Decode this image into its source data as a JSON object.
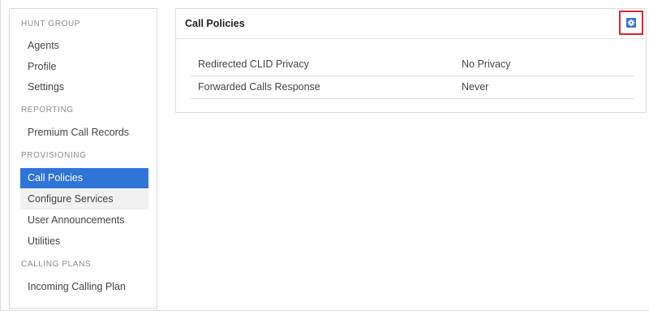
{
  "sidebar": {
    "sections": [
      {
        "heading": "HUNT GROUP",
        "items": [
          "Agents",
          "Profile",
          "Settings"
        ]
      },
      {
        "heading": "REPORTING",
        "items": [
          "Premium Call Records"
        ]
      },
      {
        "heading": "PROVISIONING",
        "items": [
          "Call Policies",
          "Configure Services",
          "User Announcements",
          "Utilities"
        ]
      },
      {
        "heading": "CALLING PLANS",
        "items": [
          "Incoming Calling Plan"
        ]
      }
    ],
    "active_item": "Call Policies",
    "hovered_item": "Configure Services"
  },
  "panel": {
    "title": "Call Policies",
    "settings_icon": "gear-icon",
    "rows": [
      {
        "label": "Redirected CLID Privacy",
        "value": "No Privacy"
      },
      {
        "label": "Forwarded Calls Response",
        "value": "Never"
      }
    ]
  },
  "colors": {
    "accent": "#2f74d6",
    "highlight_box": "#e0242a"
  }
}
